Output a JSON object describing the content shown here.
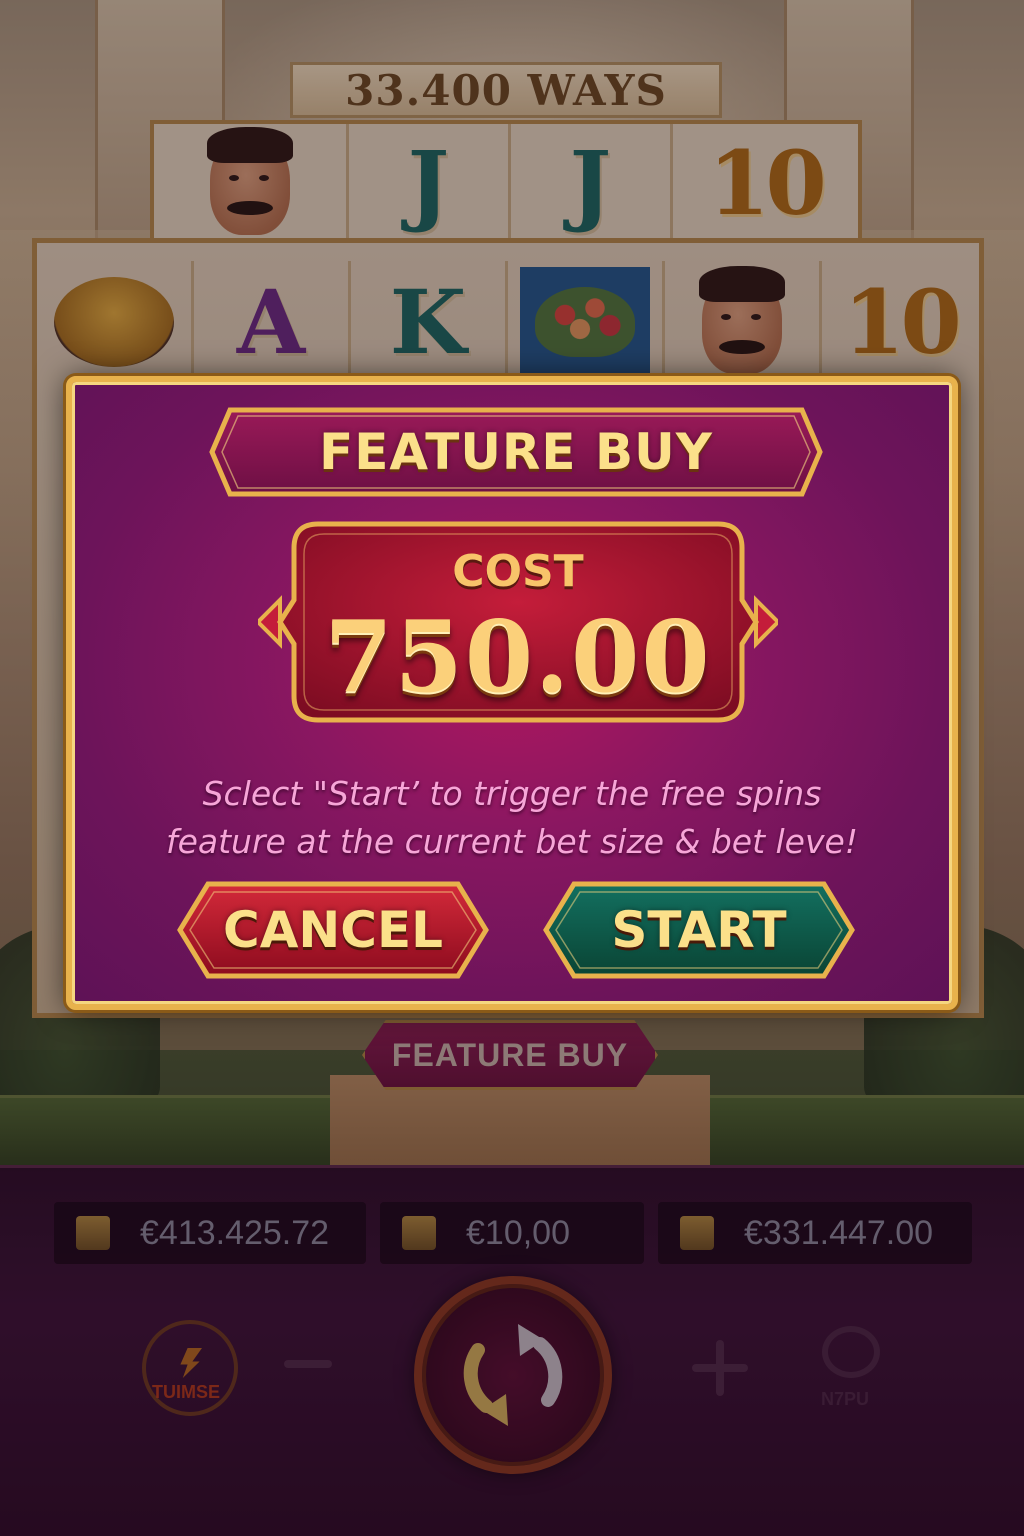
{
  "game": {
    "ways_banner": "33.400 WAYS"
  },
  "reels": {
    "top_row": [
      "man-portrait",
      "J",
      "J",
      "10"
    ],
    "second_row": [
      "spice-bowl",
      "A",
      "K",
      "flower-bush",
      "man-portrait",
      "10"
    ]
  },
  "background_button": {
    "label": "FEATURE BUY"
  },
  "modal": {
    "title": "FEATURE BUY",
    "cost_label": "COST",
    "cost_value": "750.00",
    "description_line1": "Sclect \"Start’ to trigger the free spins",
    "description_line2": "feature at the current bet size & bet leve!",
    "cancel_label": "CANCEL",
    "start_label": "START"
  },
  "bottom_bar": {
    "balance": "€413.425.72",
    "bet": "€10,00",
    "win": "€331.447.00",
    "turbo_label": "TUIMSE",
    "auto_label": "N7PU"
  },
  "colors": {
    "modal_bg": "#8a1761",
    "gold_border": "#e8b24c",
    "cancel_red": "#b3122a",
    "start_green": "#0d5a46",
    "title_gold": "#fbe08a",
    "description_pink": "#f7a6d8"
  }
}
